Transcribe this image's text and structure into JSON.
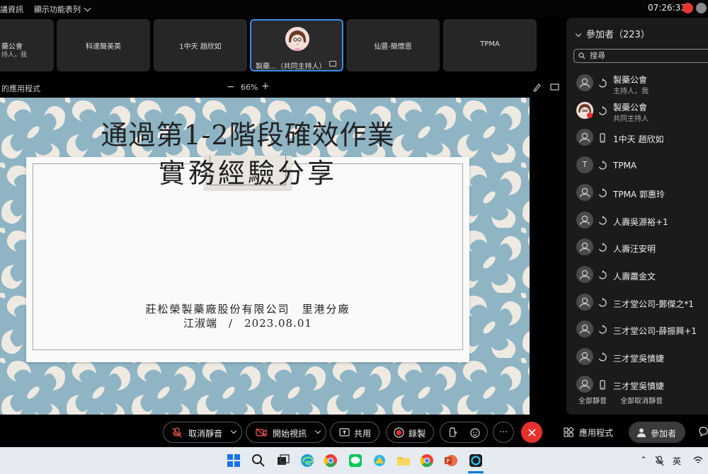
{
  "topbar": {
    "menu_info": "議資訊",
    "menu_view": "顯示功能表列",
    "clock": "07:26:33"
  },
  "video_tiles": [
    {
      "name": "藥公會",
      "sub": "持人，我"
    },
    {
      "name": "科達簡美英"
    },
    {
      "name": "1中天 趙欣如"
    },
    {
      "name": "製藥...（共同主持人）"
    },
    {
      "name": "仙豐-簡懷恩"
    },
    {
      "name": "TPMA"
    }
  ],
  "apps_row": {
    "label": "的應用程式",
    "zoom": "66%",
    "zoom_out": "−",
    "zoom_in": "+"
  },
  "slide": {
    "title_line1": "通過第1-2階段確效作業",
    "title_line2": "實務經驗分享",
    "company": "莊松榮製藥廠股份有限公司　里港分廠",
    "author_date": "江淑端　/　2023.08.01"
  },
  "panel": {
    "title": "參加者（223）",
    "search_placeholder": "搜尋",
    "participants": [
      {
        "name": "製藥公會",
        "role": "主持人，我",
        "avatar": "person-icon",
        "status": "phone-sync-icon"
      },
      {
        "name": "製藥公會",
        "role": "共同主持人",
        "avatar": "photo-avatar",
        "status": "phone-sync-icon"
      },
      {
        "name": "1中天 趙欣如",
        "avatar": "person-icon",
        "status": "mobile-icon"
      },
      {
        "name": "TPMA",
        "avatar": "T",
        "status": "phone-sync-icon"
      },
      {
        "name": "TPMA 郭惠玲",
        "avatar": "person-icon",
        "status": "phone-sync-icon"
      },
      {
        "name": "人壽吳源裕+1",
        "avatar": "person-icon",
        "status": "phone-sync-icon"
      },
      {
        "name": "人壽汪安明",
        "avatar": "person-icon",
        "status": "phone-sync-icon"
      },
      {
        "name": "人壽蕭金文",
        "avatar": "person-icon",
        "status": "phone-sync-icon"
      },
      {
        "name": "三才堂公司-鄭傑之*1",
        "avatar": "person-icon",
        "status": "phone-sync-icon"
      },
      {
        "name": "三才堂公司-薛振興+1",
        "avatar": "person-icon",
        "status": "phone-sync-icon"
      },
      {
        "name": "三才堂吳憤婕",
        "avatar": "person-icon",
        "status": "phone-sync-icon"
      },
      {
        "name": "三才堂吳憤婕",
        "avatar": "person-icon",
        "status": "mobile-icon"
      }
    ],
    "mute_all": "全部靜音",
    "unmute_all": "全部取消靜音"
  },
  "controls": {
    "unmute": "取消靜音",
    "start_video": "開始視訊",
    "share": "共用",
    "record": "錄製",
    "more": "⋯",
    "apps": "應用程式",
    "participants": "參加者"
  },
  "taskbar": {
    "lang": "英"
  },
  "colors": {
    "accent_blue": "#3f8bf0",
    "end_red": "#e5302e",
    "panel_bg": "#1b1b1b",
    "slide_bg": "#8fb4c4"
  }
}
